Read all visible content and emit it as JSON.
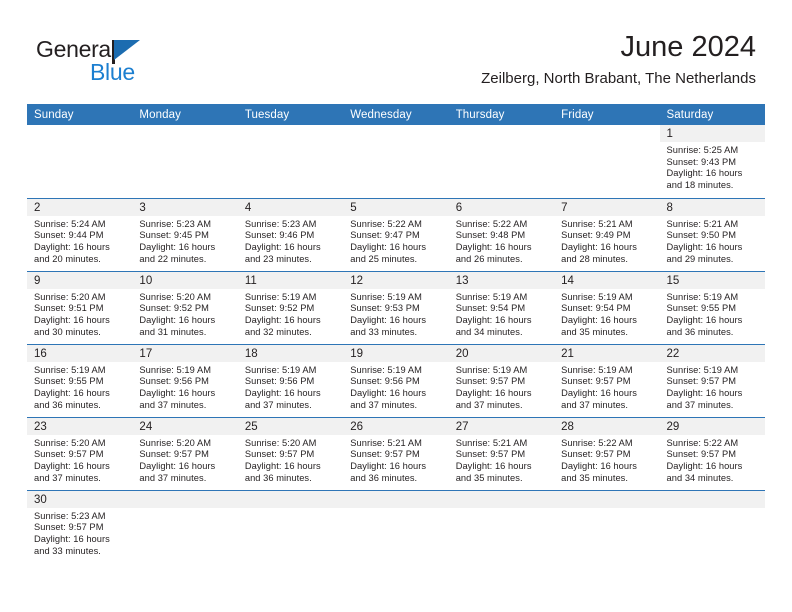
{
  "brand": {
    "name_top": "General",
    "name_bottom": "Blue",
    "flag_color": "#1c6cb0",
    "blue_text_color": "#1c7fd0"
  },
  "header": {
    "title": "June 2024",
    "subtitle": "Zeilberg, North Brabant, The Netherlands",
    "accent_color": "#2e75b6",
    "date_band_color": "#f1f1f1"
  },
  "weekday_headers": [
    "Sunday",
    "Monday",
    "Tuesday",
    "Wednesday",
    "Thursday",
    "Friday",
    "Saturday"
  ],
  "weeks": [
    [
      {
        "day": "",
        "lines": []
      },
      {
        "day": "",
        "lines": []
      },
      {
        "day": "",
        "lines": []
      },
      {
        "day": "",
        "lines": []
      },
      {
        "day": "",
        "lines": []
      },
      {
        "day": "",
        "lines": []
      },
      {
        "day": "1",
        "lines": [
          "Sunrise: 5:25 AM",
          "Sunset: 9:43 PM",
          "Daylight: 16 hours",
          "and 18 minutes."
        ]
      }
    ],
    [
      {
        "day": "2",
        "lines": [
          "Sunrise: 5:24 AM",
          "Sunset: 9:44 PM",
          "Daylight: 16 hours",
          "and 20 minutes."
        ]
      },
      {
        "day": "3",
        "lines": [
          "Sunrise: 5:23 AM",
          "Sunset: 9:45 PM",
          "Daylight: 16 hours",
          "and 22 minutes."
        ]
      },
      {
        "day": "4",
        "lines": [
          "Sunrise: 5:23 AM",
          "Sunset: 9:46 PM",
          "Daylight: 16 hours",
          "and 23 minutes."
        ]
      },
      {
        "day": "5",
        "lines": [
          "Sunrise: 5:22 AM",
          "Sunset: 9:47 PM",
          "Daylight: 16 hours",
          "and 25 minutes."
        ]
      },
      {
        "day": "6",
        "lines": [
          "Sunrise: 5:22 AM",
          "Sunset: 9:48 PM",
          "Daylight: 16 hours",
          "and 26 minutes."
        ]
      },
      {
        "day": "7",
        "lines": [
          "Sunrise: 5:21 AM",
          "Sunset: 9:49 PM",
          "Daylight: 16 hours",
          "and 28 minutes."
        ]
      },
      {
        "day": "8",
        "lines": [
          "Sunrise: 5:21 AM",
          "Sunset: 9:50 PM",
          "Daylight: 16 hours",
          "and 29 minutes."
        ]
      }
    ],
    [
      {
        "day": "9",
        "lines": [
          "Sunrise: 5:20 AM",
          "Sunset: 9:51 PM",
          "Daylight: 16 hours",
          "and 30 minutes."
        ]
      },
      {
        "day": "10",
        "lines": [
          "Sunrise: 5:20 AM",
          "Sunset: 9:52 PM",
          "Daylight: 16 hours",
          "and 31 minutes."
        ]
      },
      {
        "day": "11",
        "lines": [
          "Sunrise: 5:19 AM",
          "Sunset: 9:52 PM",
          "Daylight: 16 hours",
          "and 32 minutes."
        ]
      },
      {
        "day": "12",
        "lines": [
          "Sunrise: 5:19 AM",
          "Sunset: 9:53 PM",
          "Daylight: 16 hours",
          "and 33 minutes."
        ]
      },
      {
        "day": "13",
        "lines": [
          "Sunrise: 5:19 AM",
          "Sunset: 9:54 PM",
          "Daylight: 16 hours",
          "and 34 minutes."
        ]
      },
      {
        "day": "14",
        "lines": [
          "Sunrise: 5:19 AM",
          "Sunset: 9:54 PM",
          "Daylight: 16 hours",
          "and 35 minutes."
        ]
      },
      {
        "day": "15",
        "lines": [
          "Sunrise: 5:19 AM",
          "Sunset: 9:55 PM",
          "Daylight: 16 hours",
          "and 36 minutes."
        ]
      }
    ],
    [
      {
        "day": "16",
        "lines": [
          "Sunrise: 5:19 AM",
          "Sunset: 9:55 PM",
          "Daylight: 16 hours",
          "and 36 minutes."
        ]
      },
      {
        "day": "17",
        "lines": [
          "Sunrise: 5:19 AM",
          "Sunset: 9:56 PM",
          "Daylight: 16 hours",
          "and 37 minutes."
        ]
      },
      {
        "day": "18",
        "lines": [
          "Sunrise: 5:19 AM",
          "Sunset: 9:56 PM",
          "Daylight: 16 hours",
          "and 37 minutes."
        ]
      },
      {
        "day": "19",
        "lines": [
          "Sunrise: 5:19 AM",
          "Sunset: 9:56 PM",
          "Daylight: 16 hours",
          "and 37 minutes."
        ]
      },
      {
        "day": "20",
        "lines": [
          "Sunrise: 5:19 AM",
          "Sunset: 9:57 PM",
          "Daylight: 16 hours",
          "and 37 minutes."
        ]
      },
      {
        "day": "21",
        "lines": [
          "Sunrise: 5:19 AM",
          "Sunset: 9:57 PM",
          "Daylight: 16 hours",
          "and 37 minutes."
        ]
      },
      {
        "day": "22",
        "lines": [
          "Sunrise: 5:19 AM",
          "Sunset: 9:57 PM",
          "Daylight: 16 hours",
          "and 37 minutes."
        ]
      }
    ],
    [
      {
        "day": "23",
        "lines": [
          "Sunrise: 5:20 AM",
          "Sunset: 9:57 PM",
          "Daylight: 16 hours",
          "and 37 minutes."
        ]
      },
      {
        "day": "24",
        "lines": [
          "Sunrise: 5:20 AM",
          "Sunset: 9:57 PM",
          "Daylight: 16 hours",
          "and 37 minutes."
        ]
      },
      {
        "day": "25",
        "lines": [
          "Sunrise: 5:20 AM",
          "Sunset: 9:57 PM",
          "Daylight: 16 hours",
          "and 36 minutes."
        ]
      },
      {
        "day": "26",
        "lines": [
          "Sunrise: 5:21 AM",
          "Sunset: 9:57 PM",
          "Daylight: 16 hours",
          "and 36 minutes."
        ]
      },
      {
        "day": "27",
        "lines": [
          "Sunrise: 5:21 AM",
          "Sunset: 9:57 PM",
          "Daylight: 16 hours",
          "and 35 minutes."
        ]
      },
      {
        "day": "28",
        "lines": [
          "Sunrise: 5:22 AM",
          "Sunset: 9:57 PM",
          "Daylight: 16 hours",
          "and 35 minutes."
        ]
      },
      {
        "day": "29",
        "lines": [
          "Sunrise: 5:22 AM",
          "Sunset: 9:57 PM",
          "Daylight: 16 hours",
          "and 34 minutes."
        ]
      }
    ],
    [
      {
        "day": "30",
        "lines": [
          "Sunrise: 5:23 AM",
          "Sunset: 9:57 PM",
          "Daylight: 16 hours",
          "and 33 minutes."
        ]
      },
      {
        "day": "",
        "lines": []
      },
      {
        "day": "",
        "lines": []
      },
      {
        "day": "",
        "lines": []
      },
      {
        "day": "",
        "lines": []
      },
      {
        "day": "",
        "lines": []
      },
      {
        "day": "",
        "lines": []
      }
    ]
  ]
}
